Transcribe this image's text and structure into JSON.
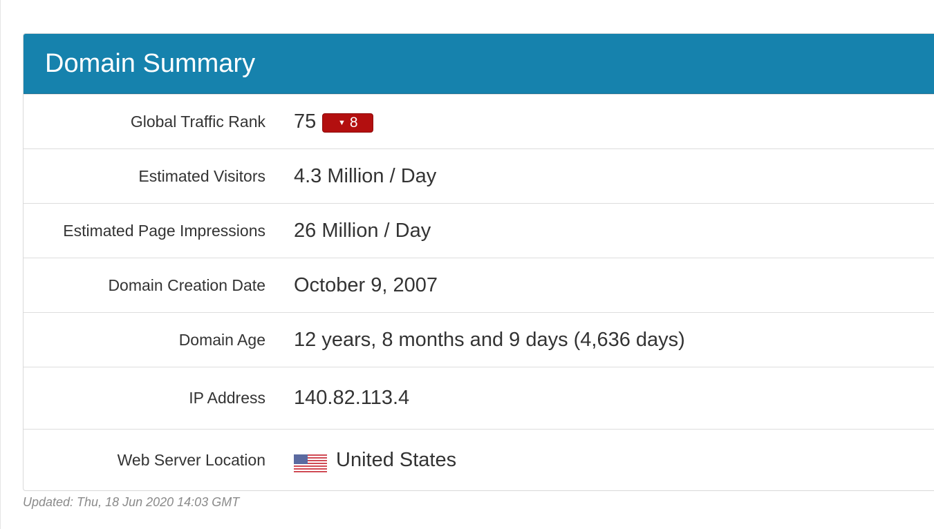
{
  "panel": {
    "title": "Domain Summary"
  },
  "rows": {
    "traffic_rank": {
      "label": "Global Traffic Rank",
      "value": "75",
      "change": "8",
      "change_direction": "down",
      "change_color": "#b30f0f"
    },
    "visitors": {
      "label": "Estimated Visitors",
      "value": "4.3 Million / Day"
    },
    "impressions": {
      "label": "Estimated Page Impressions",
      "value": "26 Million / Day"
    },
    "creation_date": {
      "label": "Domain Creation Date",
      "value": "October 9, 2007"
    },
    "age": {
      "label": "Domain Age",
      "value": "12 years, 8 months and 9 days (4,636 days)"
    },
    "ip": {
      "label": "IP Address",
      "value": "140.82.113.4"
    },
    "location": {
      "label": "Web Server Location",
      "value": "United States",
      "flag_icon": "us-flag-icon"
    }
  },
  "footer": {
    "updated": "Updated: Thu, 18 Jun 2020 14:03 GMT"
  },
  "colors": {
    "header_bg": "#1682ad",
    "badge_bg": "#b30f0f"
  }
}
